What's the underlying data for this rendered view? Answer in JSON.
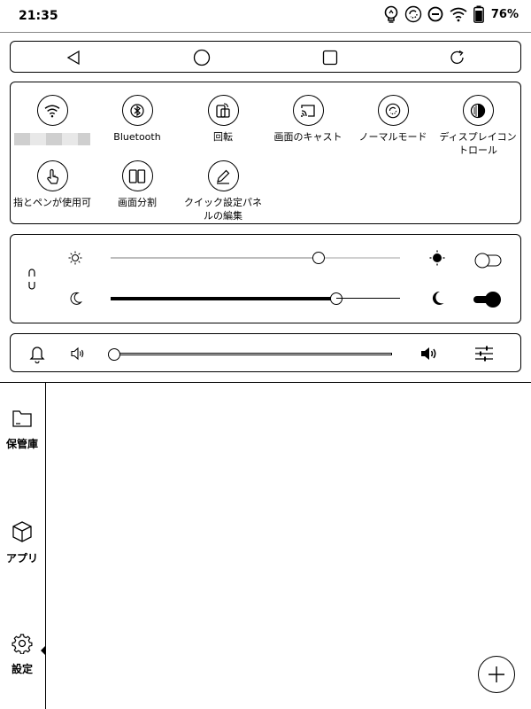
{
  "status_bar": {
    "time": "21:35",
    "battery_percent": "76%"
  },
  "nav_bar": {
    "buttons": [
      "back",
      "home",
      "recents",
      "refresh"
    ]
  },
  "quick_settings": {
    "tiles": [
      {
        "id": "wifi",
        "label": "",
        "icon": "wifi-icon",
        "label_obscured": true
      },
      {
        "id": "bluetooth",
        "label": "Bluetooth",
        "icon": "bluetooth-icon"
      },
      {
        "id": "rotate",
        "label": "回転",
        "icon": "rotate-icon"
      },
      {
        "id": "cast",
        "label": "画面のキャスト",
        "icon": "cast-icon"
      },
      {
        "id": "normal-mode",
        "label": "ノーマルモード",
        "icon": "refresh-mode-icon"
      },
      {
        "id": "display-control",
        "label": "ディスプレイコントロール",
        "icon": "contrast-icon"
      },
      {
        "id": "finger-pen",
        "label": "指とペンが使用可",
        "icon": "finger-touch-icon"
      },
      {
        "id": "split-screen",
        "label": "画面分割",
        "icon": "split-screen-icon"
      },
      {
        "id": "edit-panel",
        "label": "クイック設定パネルの編集",
        "icon": "pencil-icon"
      }
    ]
  },
  "brightness": {
    "warm_level": 0.72,
    "cold_level": 0.78,
    "warm_toggle": false,
    "cold_toggle": true,
    "linked": true
  },
  "volume": {
    "level": 0.0
  },
  "sidebar": {
    "items": [
      {
        "label": "保管庫",
        "icon": "folder-icon"
      },
      {
        "label": "アプリ",
        "icon": "cube-icon"
      },
      {
        "label": "設定",
        "icon": "gear-icon",
        "active": true
      }
    ]
  },
  "fab": {
    "icon": "plus-icon"
  }
}
